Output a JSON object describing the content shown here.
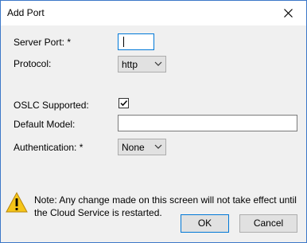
{
  "window": {
    "title": "Add Port",
    "close_icon": "close-icon"
  },
  "form": {
    "server_port_label": "Server Port:  *",
    "server_port_value": "",
    "protocol_label": "Protocol:",
    "protocol_value": "http",
    "oslc_label": "OSLC Supported:",
    "oslc_checked": true,
    "default_model_label": "Default Model:",
    "default_model_value": "",
    "auth_label": "Authentication:  *",
    "auth_value": "None"
  },
  "note": {
    "icon": "warning-icon",
    "text": "Note: Any change made on this screen will not take effect until the Cloud Service is restarted."
  },
  "buttons": {
    "ok": "OK",
    "cancel": "Cancel"
  },
  "colors": {
    "accent": "#0078d7",
    "warning": "#f5c518",
    "window_border": "#3c78c8"
  }
}
